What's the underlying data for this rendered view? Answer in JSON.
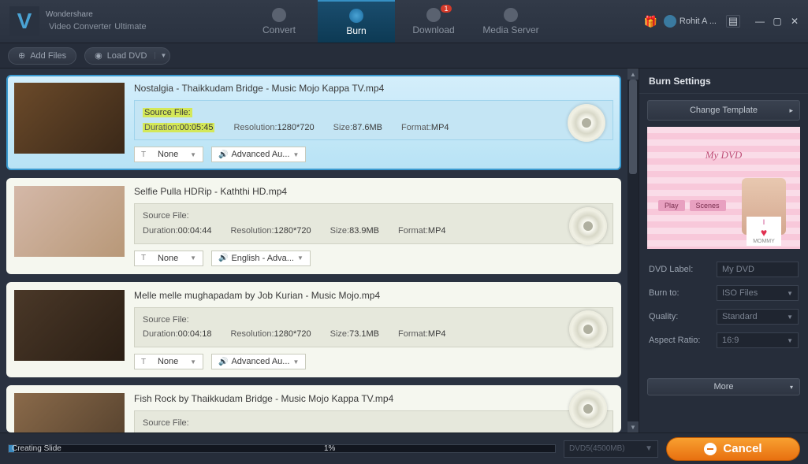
{
  "app": {
    "brand_top": "Wondershare",
    "brand_main": "Video Converter",
    "brand_suffix": "Ultimate",
    "user": "Rohit A ..."
  },
  "tabs": {
    "convert": "Convert",
    "burn": "Burn",
    "download": "Download",
    "download_badge": "1",
    "media_server": "Media Server"
  },
  "toolbar": {
    "add_files": "Add Files",
    "load_dvd": "Load DVD"
  },
  "items": [
    {
      "title": "Nostalgia - Thaikkudam Bridge - Music Mojo Kappa TV.mp4",
      "source_label": "Source File:",
      "duration_label": "Duration:",
      "duration": "00:05:45",
      "resolution_label": "Resolution:",
      "resolution": "1280*720",
      "size_label": "Size:",
      "size": "87.6MB",
      "format_label": "Format:",
      "format": "MP4",
      "subtitle": "None",
      "audio": "Advanced Au...",
      "active": true
    },
    {
      "title": "Selfie Pulla HDRip - Kaththi HD.mp4",
      "source_label": "Source File:",
      "duration_label": "Duration:",
      "duration": "00:04:44",
      "resolution_label": "Resolution:",
      "resolution": "1280*720",
      "size_label": "Size:",
      "size": "83.9MB",
      "format_label": "Format:",
      "format": "MP4",
      "subtitle": "None",
      "audio": "English - Adva..."
    },
    {
      "title": "Melle melle mughapadam by Job Kurian - Music Mojo.mp4",
      "source_label": "Source File:",
      "duration_label": "Duration:",
      "duration": "00:04:18",
      "resolution_label": "Resolution:",
      "resolution": "1280*720",
      "size_label": "Size:",
      "size": "73.1MB",
      "format_label": "Format:",
      "format": "MP4",
      "subtitle": "None",
      "audio": "Advanced Au..."
    },
    {
      "title": "Fish Rock by Thaikkudam Bridge - Music Mojo Kappa TV.mp4",
      "source_label": "Source File:",
      "subtitle": "",
      "audio": ""
    }
  ],
  "right": {
    "header": "Burn Settings",
    "change_template": "Change Template",
    "preview_title": "My DVD",
    "menu_play": "Play",
    "menu_scenes": "Scenes",
    "love_text": "MOMMY",
    "i_text": "I",
    "dvd_label_lbl": "DVD Label:",
    "dvd_label_val": "My DVD",
    "burn_to_lbl": "Burn to:",
    "burn_to_val": "ISO Files",
    "quality_lbl": "Quality:",
    "quality_val": "Standard",
    "aspect_lbl": "Aspect Ratio:",
    "aspect_val": "16:9",
    "more": "More"
  },
  "footer": {
    "status": "Creating Slide",
    "percent": "1%",
    "dvd_size": "DVD5(4500MB)",
    "cancel": "Cancel"
  }
}
